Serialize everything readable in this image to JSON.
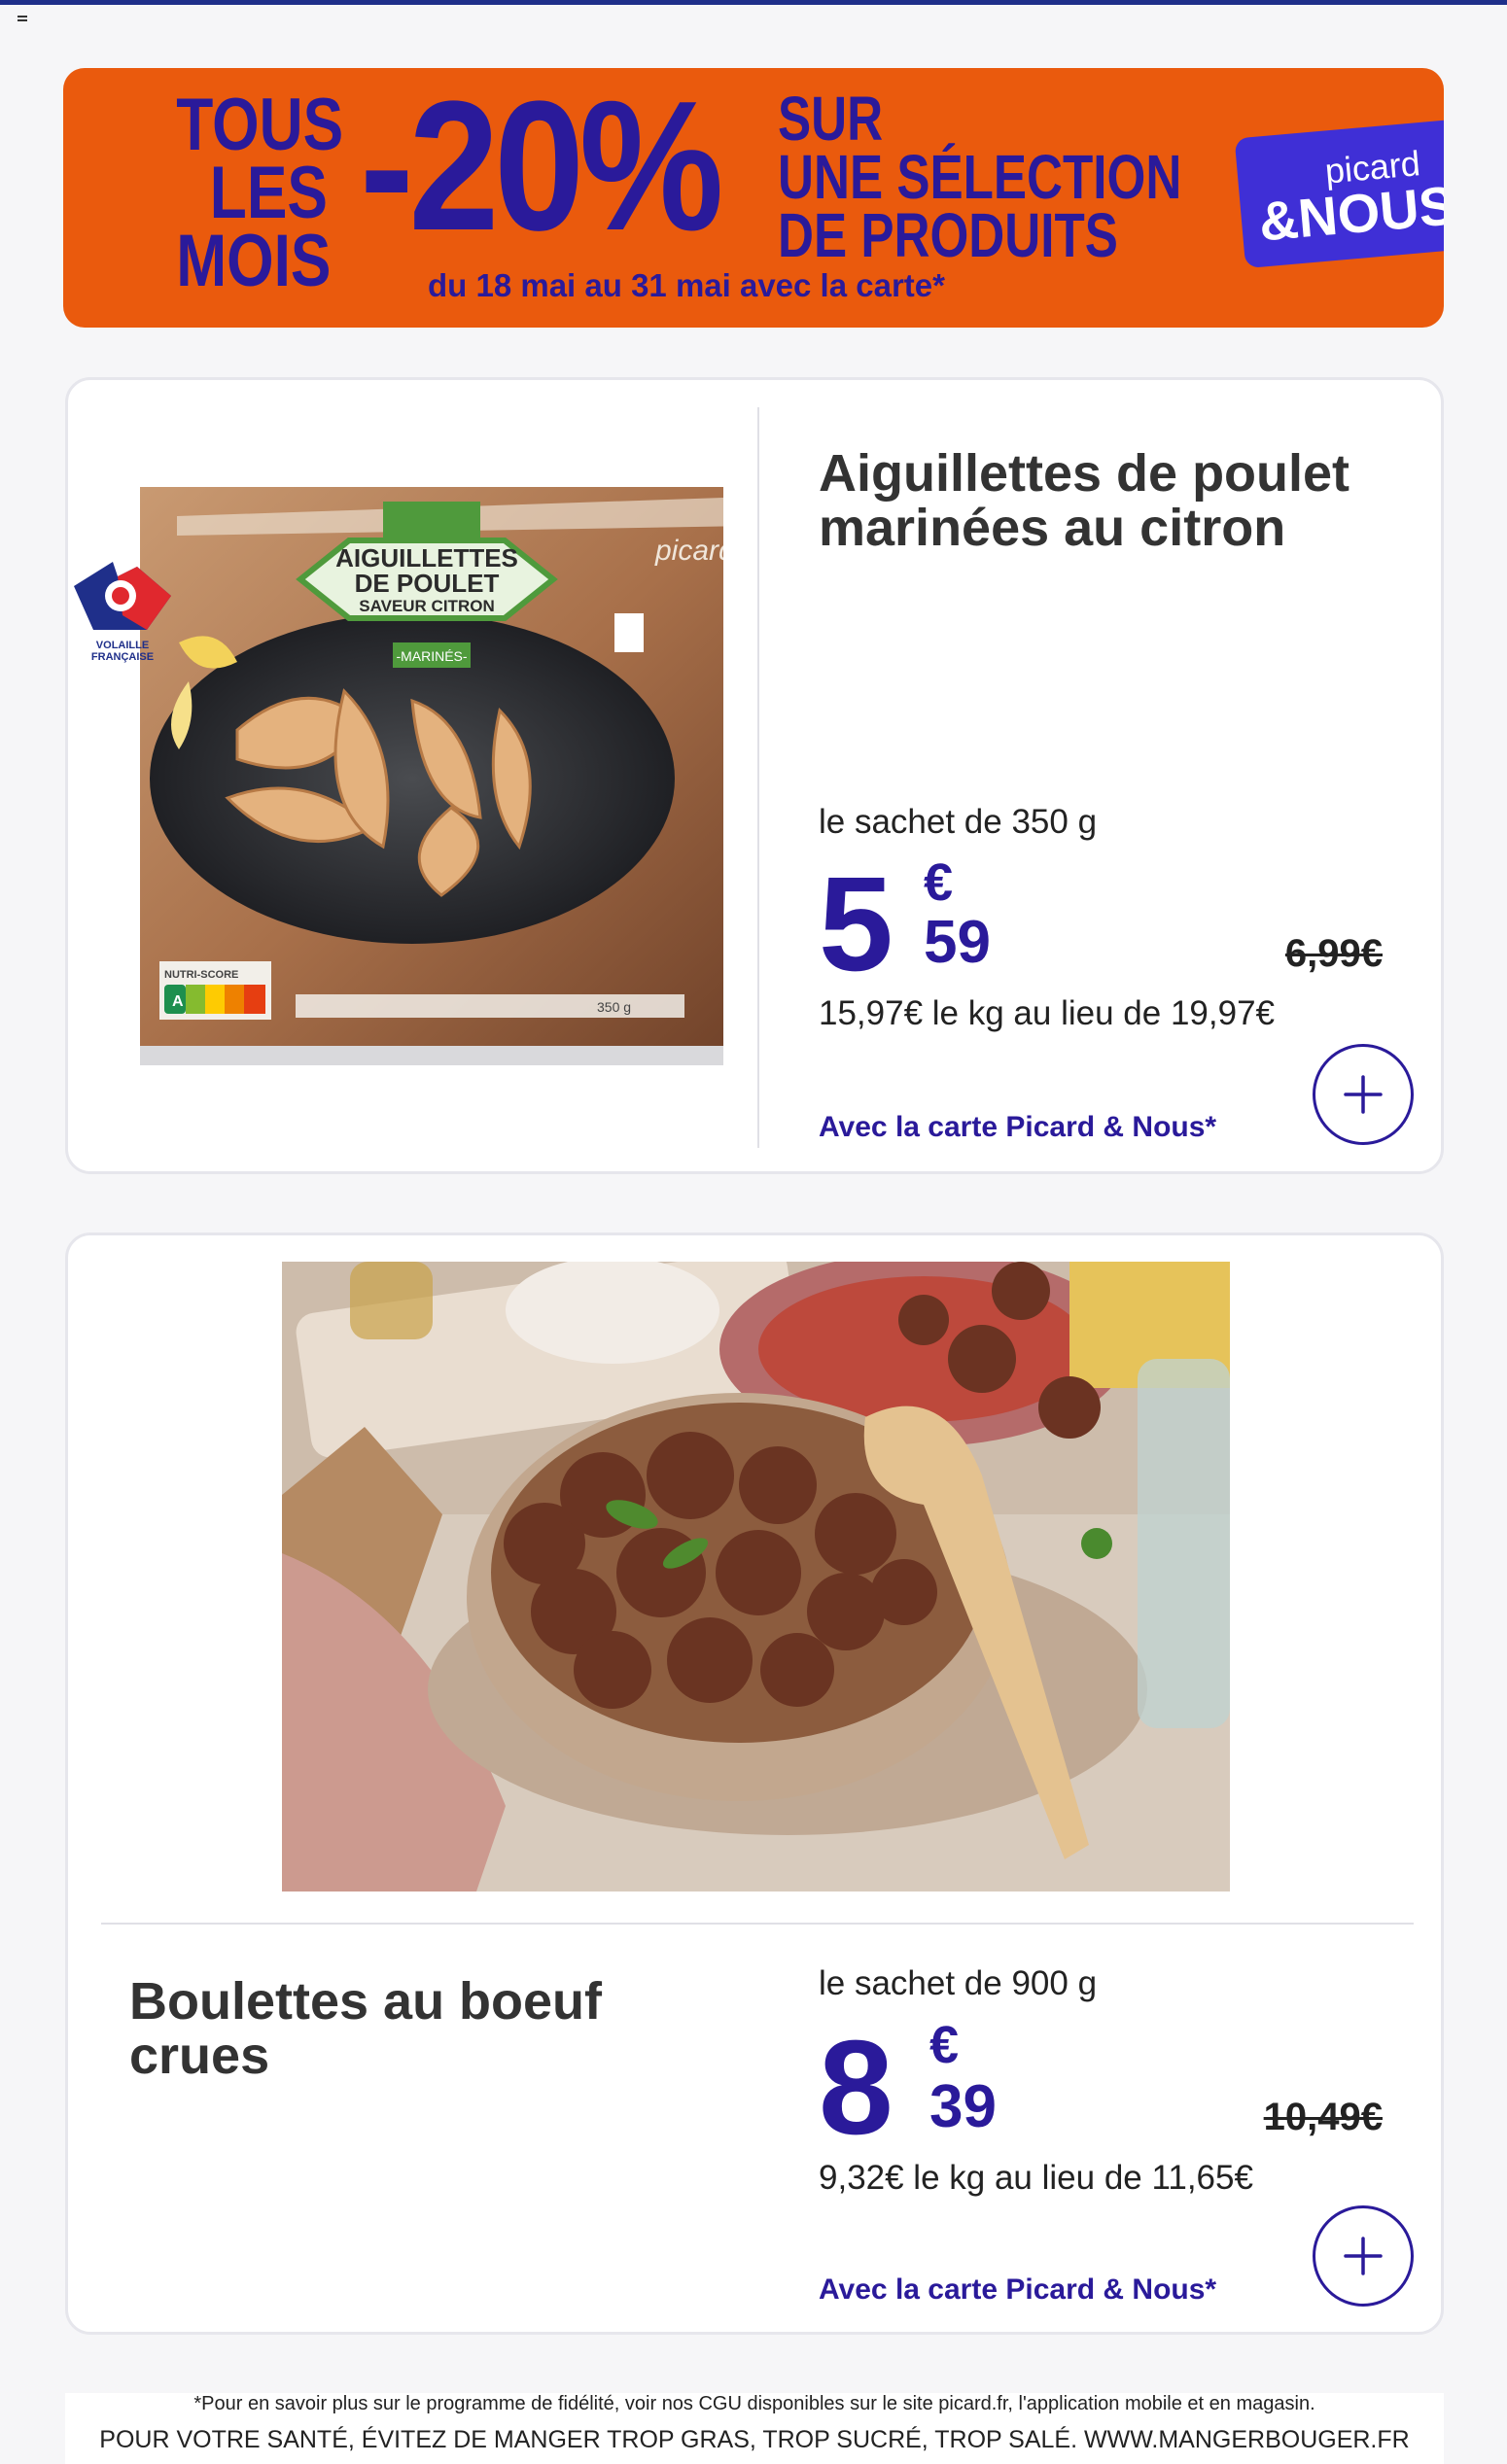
{
  "banner": {
    "line1": "TOUS",
    "line2": "LES",
    "line3": "MOIS",
    "discount": "-20%",
    "sel1": "SUR",
    "sel2": "UNE SÉLECTION",
    "sel3": "DE PRODUITS",
    "dates": "du 18 mai au 31 mai avec la carte*",
    "logo_top": "picard",
    "logo_bottom": "&NOUS",
    "color": "#ea5a0d",
    "accent": "#2a1a9a"
  },
  "products": [
    {
      "title": "Aiguillettes de poulet marinées au citron",
      "pack": "le sachet de 350 g",
      "price_int": "5",
      "price_cur": "€",
      "price_cents": "59",
      "old_price": "6,99€",
      "per_kg": "15,97€ le kg au lieu de 19,97€",
      "carte": "Avec la carte Picard & Nous*",
      "image_icon": "product-package-image",
      "package_text": {
        "name1": "AIGUILLETTES",
        "name2": "DE POULET",
        "name3": "SAVEUR CITRON",
        "marines": "-MARINÉS-",
        "brand": "picard",
        "nutri": "NUTRI-SCORE",
        "weight": "350 g"
      },
      "badge": {
        "line1": "VOLAILLE",
        "line2": "FRANÇAISE"
      }
    },
    {
      "title": "Boulettes au boeuf crues",
      "pack": "le sachet de 900 g",
      "price_int": "8",
      "price_cur": "€",
      "price_cents": "39",
      "old_price": "10,49€",
      "per_kg": "9,32€ le kg au lieu de 11,65€",
      "carte": "Avec la carte Picard & Nous*",
      "image_icon": "meatballs-photo"
    }
  ],
  "footer": {
    "note": "*Pour en savoir plus sur le programme de fidélité, voir nos CGU disponibles sur le site picard.fr, l'application mobile et en magasin.",
    "health": "POUR VOTRE SANTÉ, ÉVITEZ DE MANGER TROP GRAS, TROP SUCRÉ, TROP SALÉ. WWW.MANGERBOUGER.FR"
  }
}
